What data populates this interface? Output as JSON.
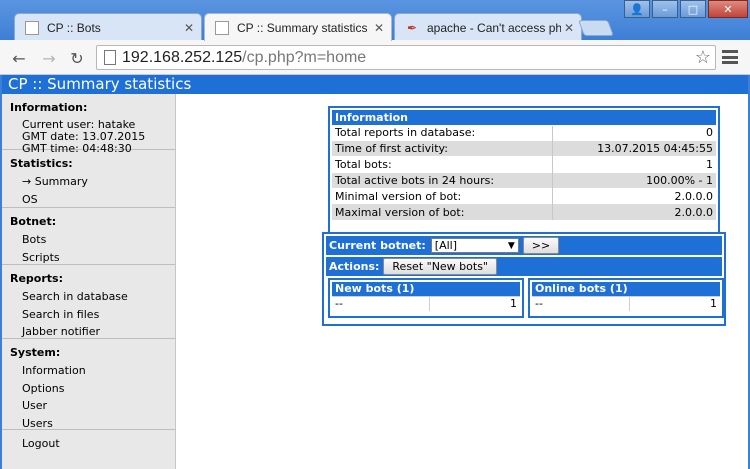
{
  "browser": {
    "tabs": [
      {
        "title": "CP :: Bots",
        "active": false
      },
      {
        "title": "CP :: Summary statistics",
        "active": true
      },
      {
        "title": "apache - Can't access php fil",
        "active": false
      }
    ],
    "url_host": "192.168.252.125",
    "url_path": "/cp.php?m=home",
    "window_buttons": {
      "user": "👤",
      "minimize": "–",
      "maximize": "□",
      "close": "✕"
    }
  },
  "page": {
    "header": "CP :: Summary statistics"
  },
  "sidebar": {
    "information": {
      "title": "Information:",
      "user": "Current user: hatake",
      "date": "GMT date: 13.07.2015",
      "time": "GMT time: 04:48:30"
    },
    "statistics": {
      "title": "Statistics:",
      "items": [
        "→ Summary",
        "OS"
      ]
    },
    "botnet": {
      "title": "Botnet:",
      "items": [
        "Bots",
        "Scripts"
      ]
    },
    "reports": {
      "title": "Reports:",
      "items": [
        "Search in database",
        "Search in files",
        "Jabber notifier"
      ]
    },
    "system": {
      "title": "System:",
      "items": [
        "Information",
        "Options",
        "User",
        "Users"
      ]
    },
    "logout": "Logout"
  },
  "info_table": {
    "title": "Information",
    "rows": [
      {
        "label": "Total reports in database:",
        "value": "0"
      },
      {
        "label": "Time of first activity:",
        "value": "13.07.2015 04:45:55"
      },
      {
        "label": "Total bots:",
        "value": "1"
      },
      {
        "label": "Total active bots in 24 hours:",
        "value": "100.00% - 1"
      },
      {
        "label": "Minimal version of bot:",
        "value": "2.0.0.0"
      },
      {
        "label": "Maximal version of bot:",
        "value": "2.0.0.0"
      }
    ]
  },
  "botnet_panel": {
    "current_label": "Current botnet:",
    "select_value": "[All]",
    "go_button": ">>",
    "actions_label": "Actions:",
    "reset_button": "Reset \"New bots\"",
    "new_bots": {
      "title": "New bots (1)",
      "left": "--",
      "right": "1"
    },
    "online_bots": {
      "title": "Online bots (1)",
      "left": "--",
      "right": "1"
    }
  }
}
